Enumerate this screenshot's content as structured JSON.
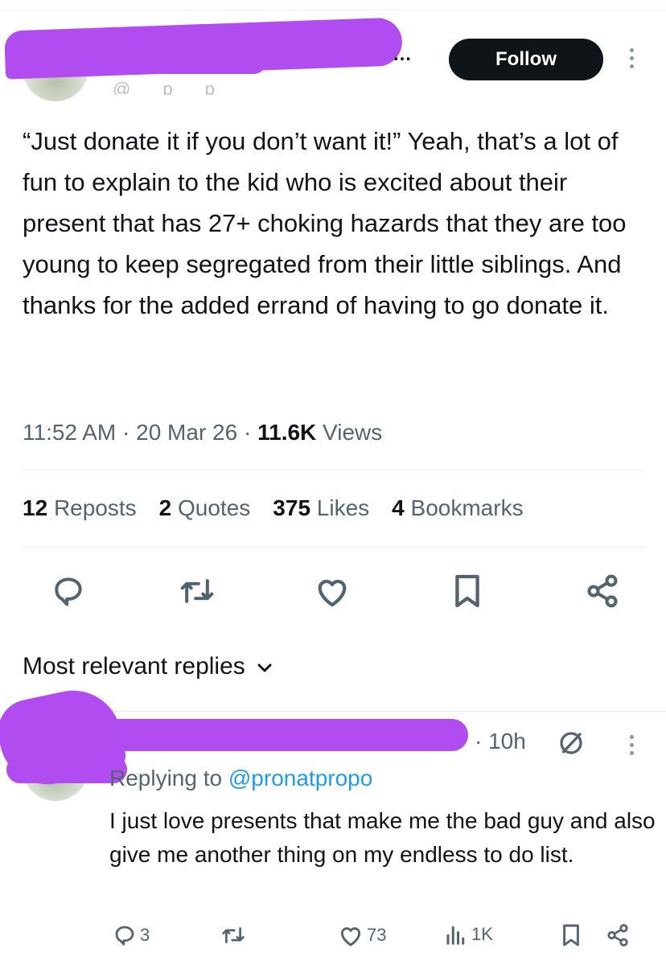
{
  "tweet": {
    "author_name_tail": "…",
    "follow_label": "Follow",
    "text": "“Just donate it if you don’t want it!” Yeah, that’s a lot of fun to explain to the kid who is excited about their present that has 27+ choking hazards that they are too young to keep segregated from their little siblings. And thanks for the added errand of having to go donate it.",
    "time": "11:52 AM",
    "date": "20 Mar 26",
    "views_count": "11.6K",
    "views_label": "Views",
    "separator": "·",
    "stats": [
      {
        "count": "12",
        "label": "Reposts"
      },
      {
        "count": "2",
        "label": "Quotes"
      },
      {
        "count": "375",
        "label": "Likes"
      },
      {
        "count": "4",
        "label": "Bookmarks"
      }
    ],
    "actions": [
      "reply-icon",
      "repost-icon",
      "like-icon",
      "bookmark-icon",
      "share-icon"
    ]
  },
  "replies_sort_label": "Most relevant replies",
  "reply": {
    "time": "· 10h",
    "replying_prefix": "Replying to",
    "replying_handle": "@pronatpropo",
    "text": "I just love presents that make me the bad guy and also give me another thing on my endless to do list.",
    "counts": {
      "replies": "3",
      "likes": "73",
      "views": "1K"
    }
  },
  "colors": {
    "text_primary": "#0f1419",
    "text_secondary": "#536471",
    "link": "#1d9bf0",
    "redaction": "#b04cf0",
    "button_bg": "#0f1419"
  }
}
